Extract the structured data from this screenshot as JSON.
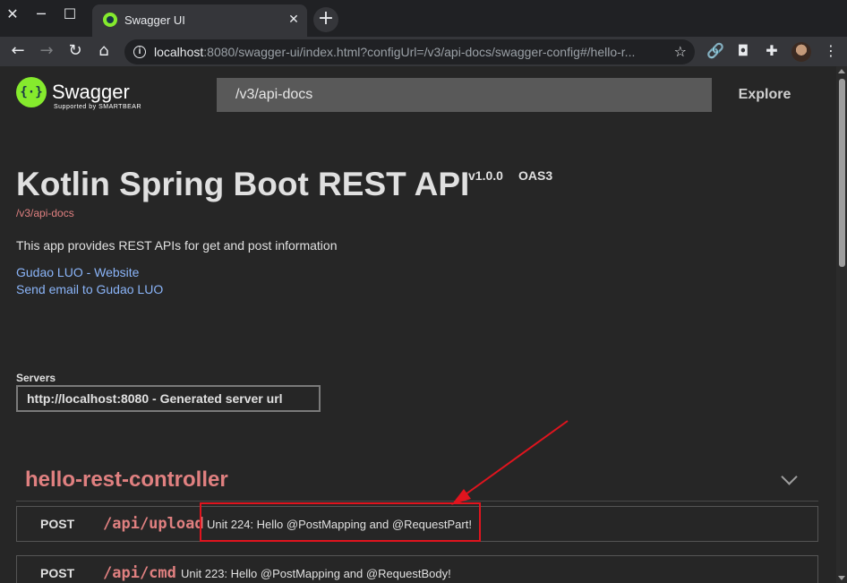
{
  "browser": {
    "tab_title": "Swagger UI",
    "url_host": "localhost",
    "url_rest": ":8080/swagger-ui/index.html?configUrl=/v3/api-docs/swagger-config#/hello-r...",
    "icons": {
      "close_window": "close-icon",
      "minimize": "minimize-icon",
      "maximize": "maximize-icon",
      "back": "back-arrow-icon",
      "forward": "forward-arrow-icon",
      "reload": "reload-icon",
      "home": "home-icon",
      "site_info": "info-icon",
      "bookmark": "star-icon"
    }
  },
  "swagger": {
    "logo_text": "Swagger",
    "logo_sub": "Supported by SMARTBEAR",
    "api_url_value": "/v3/api-docs",
    "explore_label": "Explore",
    "title": "Kotlin Spring Boot REST API",
    "version": "v1.0.0",
    "oas": "OAS3",
    "spec_link": "/v3/api-docs",
    "description": "This app provides REST APIs for get and post information",
    "contact_website": "Gudao LUO - Website",
    "contact_email": "Send email to Gudao LUO",
    "servers_label": "Servers",
    "server_selected": "http://localhost:8080 - Generated server url",
    "tag_name": "hello-rest-controller",
    "operations": [
      {
        "method": "POST",
        "path": "/api/upload",
        "summary": "Unit 224: Hello @PostMapping and @RequestPart!"
      },
      {
        "method": "POST",
        "path": "/api/cmd",
        "summary": "Unit 223: Hello @PostMapping and @RequestBody!"
      }
    ]
  },
  "colors": {
    "page_bg": "#262626",
    "accent_red": "#e08080",
    "link_blue": "#8ab4f8",
    "swagger_green": "#85ea2d",
    "annotation_red": "#e0141e"
  }
}
